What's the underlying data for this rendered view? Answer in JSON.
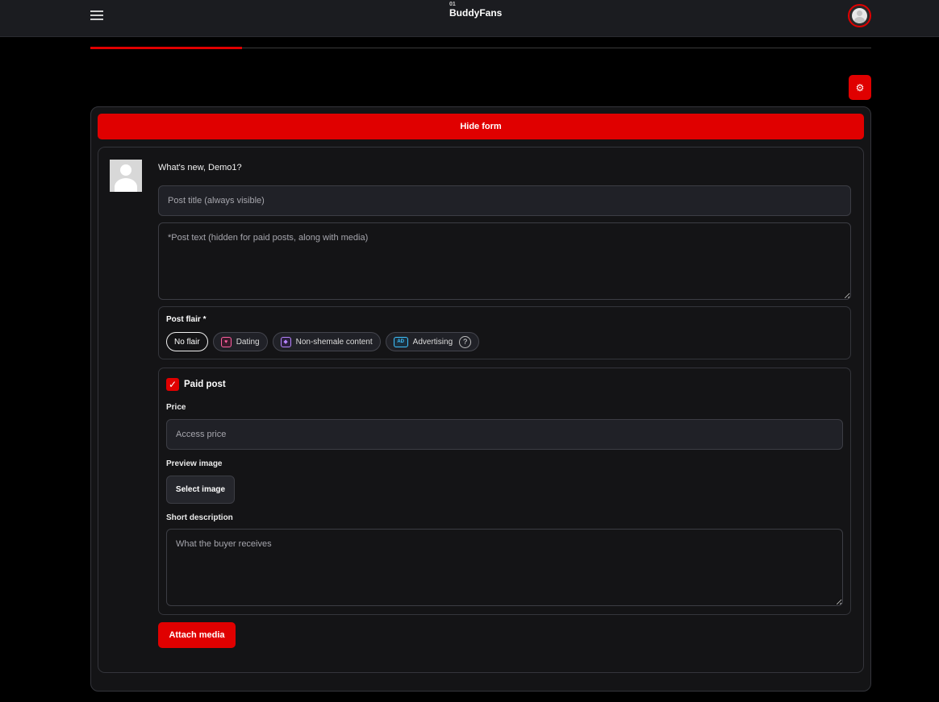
{
  "header": {
    "brand_sup": "01",
    "brand_name": "BuddyFans",
    "menu_icon": "hamburger-icon",
    "avatar_icon": "user-avatar-icon"
  },
  "progress": {
    "fraction": 0.194,
    "accent": "#e00000"
  },
  "settings": {
    "icon": "gear-icon"
  },
  "form": {
    "hide_label": "Hide form",
    "greeting": "What's new, Demo1?",
    "title_placeholder": "Post title (always visible)",
    "text_placeholder": "*Post text (hidden for paid posts, along with media)",
    "flair": {
      "label": "Post flair *",
      "options": [
        {
          "label": "No flair",
          "selected": true
        },
        {
          "label": "Dating",
          "icon": "heart-icon"
        },
        {
          "label": "Non-shemale content",
          "icon": "diamond-icon"
        },
        {
          "label": "Advertising",
          "icon": "ad-icon",
          "icon_text": "AD",
          "help": "?"
        }
      ]
    },
    "paid": {
      "checked": true,
      "label": "Paid post",
      "price_label": "Price",
      "price_placeholder": "Access price",
      "preview_label": "Preview image",
      "select_image": "Select image",
      "desc_label": "Short description",
      "desc_placeholder": "What the buyer receives"
    },
    "attach_label": "Attach media"
  },
  "colors": {
    "accent": "#e00000",
    "background": "#000000",
    "card": "#141416",
    "input": "#202127"
  }
}
